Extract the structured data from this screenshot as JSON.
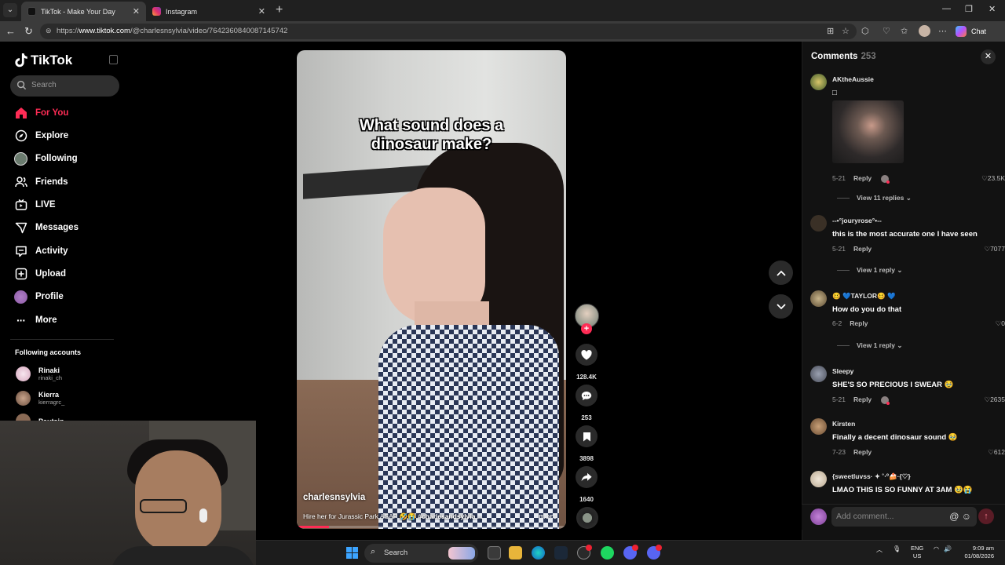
{
  "browser": {
    "tabs": [
      {
        "title": "TikTok - Make Your Day",
        "active": true
      },
      {
        "title": "Instagram",
        "active": false
      }
    ],
    "url_prefix": "https://",
    "url_host": "www.tiktok.com",
    "url_path": "/@charlesnsylvia/video/7642360840087145742",
    "chat_label": "Chat"
  },
  "sidebar": {
    "brand": "TikTok",
    "search_placeholder": "Search",
    "nav": [
      {
        "label": "For You",
        "icon": "home-icon",
        "active": true
      },
      {
        "label": "Explore",
        "icon": "compass-icon"
      },
      {
        "label": "Following",
        "icon": "following-avatar-icon"
      },
      {
        "label": "Friends",
        "icon": "friends-icon"
      },
      {
        "label": "LIVE",
        "icon": "live-icon"
      },
      {
        "label": "Messages",
        "icon": "messages-icon"
      },
      {
        "label": "Activity",
        "icon": "activity-icon"
      },
      {
        "label": "Upload",
        "icon": "upload-icon"
      },
      {
        "label": "Profile",
        "icon": "profile-avatar-icon"
      },
      {
        "label": "More",
        "icon": "more-icon"
      }
    ],
    "following_title": "Following accounts",
    "following_accounts": [
      {
        "name": "Rinaki",
        "handle": "rinaki_ch"
      },
      {
        "name": "Kierra",
        "handle": "kierragrc_"
      },
      {
        "name": "Pautsin",
        "handle": ""
      }
    ]
  },
  "video": {
    "overlay_text_line1": "What sound does a",
    "overlay_text_line2": "dinosaur make?",
    "author": "charlesnsylvia",
    "caption_text": "Hire her for Jurassic Park ASAP 🤣😭 ",
    "caption_tags": "#charlesandsylvia ...",
    "more_label": "more",
    "progress": 0.12
  },
  "actions": {
    "likes": "128.4K",
    "comments": "253",
    "saves": "3898",
    "shares": "1640"
  },
  "comments_panel": {
    "title": "Comments",
    "count": "253",
    "add_placeholder": "Add comment...",
    "items": [
      {
        "user": "AKtheAussie",
        "text": "□",
        "date": "5-21",
        "reply": "Reply",
        "likes": "23.5K",
        "replies": "View 11 replies",
        "has_image": true,
        "creator_liked": true
      },
      {
        "user": "--•°jouryrose°•--",
        "text": "this is the most accurate one I have seen",
        "date": "5-21",
        "reply": "Reply",
        "likes": "7077",
        "replies": "View 1 reply"
      },
      {
        "user": "🥴 💙TAYLOR🥴 💙",
        "text": "How do you do that",
        "date": "6-2",
        "reply": "Reply",
        "likes": "0",
        "replies": "View 1 reply"
      },
      {
        "user": "Sleepy",
        "text": "SHE'S SO PRECIOUS I SWEAR 🥹",
        "date": "5-21",
        "reply": "Reply",
        "likes": "2635",
        "creator_liked": true
      },
      {
        "user": "Kirsten",
        "text": "Finally a decent dinosaur sound 🥹",
        "date": "7-23",
        "reply": "Reply",
        "likes": "612"
      },
      {
        "user": "{sweetluvss· ✦ ˚‧º🍰·{♡}",
        "text": "LMAO THIS IS SO FUNNY AT 3AM 🥹😭"
      }
    ]
  },
  "taskbar": {
    "search_placeholder": "Search",
    "lang_line1": "ENG",
    "lang_line2": "US",
    "time": "9:09 am",
    "date": "01/08/2026"
  },
  "colors": {
    "accent": "#fe2c55",
    "background": "#000000",
    "panel": "#121212"
  }
}
